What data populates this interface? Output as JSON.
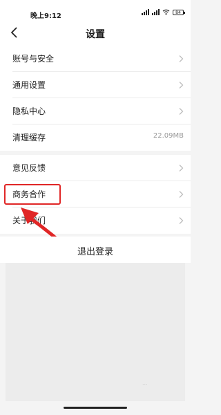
{
  "status_bar": {
    "time": "晚上9:12",
    "battery": "84"
  },
  "nav": {
    "title": "设置"
  },
  "settings_group_1": [
    {
      "label": "账号与安全",
      "value": ""
    },
    {
      "label": "通用设置",
      "value": ""
    },
    {
      "label": "隐私中心",
      "value": ""
    },
    {
      "label": "清理缓存",
      "value": "22.09MB"
    }
  ],
  "settings_group_2": [
    {
      "label": "意见反馈",
      "value": ""
    },
    {
      "label": "商务合作",
      "value": ""
    },
    {
      "label": "关于我们",
      "value": ""
    }
  ],
  "logout": {
    "label": "退出登录"
  },
  "footer": {
    "faint_text": "..."
  },
  "colors": {
    "highlight": "#e02626",
    "background": "#f4f4f4"
  }
}
